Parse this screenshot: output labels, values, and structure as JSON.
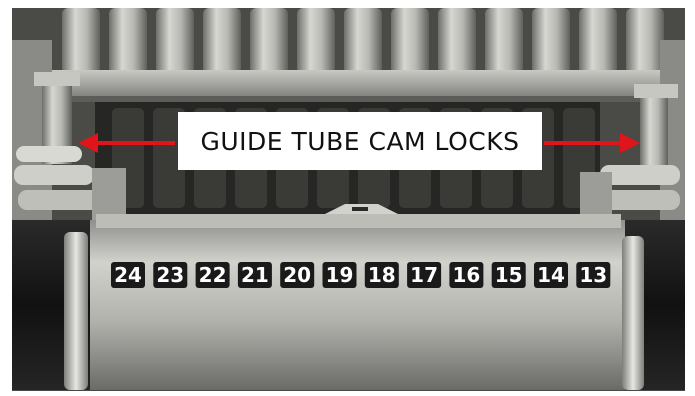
{
  "photo": {
    "subject": "machine-guide-tubes",
    "colors": {
      "steel": "#a9aaa7",
      "steel_light": "#d4d4cf",
      "steel_dark": "#6e6f6b",
      "shadow": "#1c1c1c",
      "rubber": "#161616",
      "label_bg": "#1a1a1a",
      "label_text": "#ffffff",
      "arrow": "#e0141b",
      "callout_bg": "#ffffff",
      "callout_text": "#111111"
    }
  },
  "callout": {
    "text": "GUIDE TUBE CAM LOCKS"
  },
  "tube_numbers": [
    "24",
    "23",
    "22",
    "21",
    "20",
    "19",
    "18",
    "17",
    "16",
    "15",
    "14",
    "13"
  ]
}
